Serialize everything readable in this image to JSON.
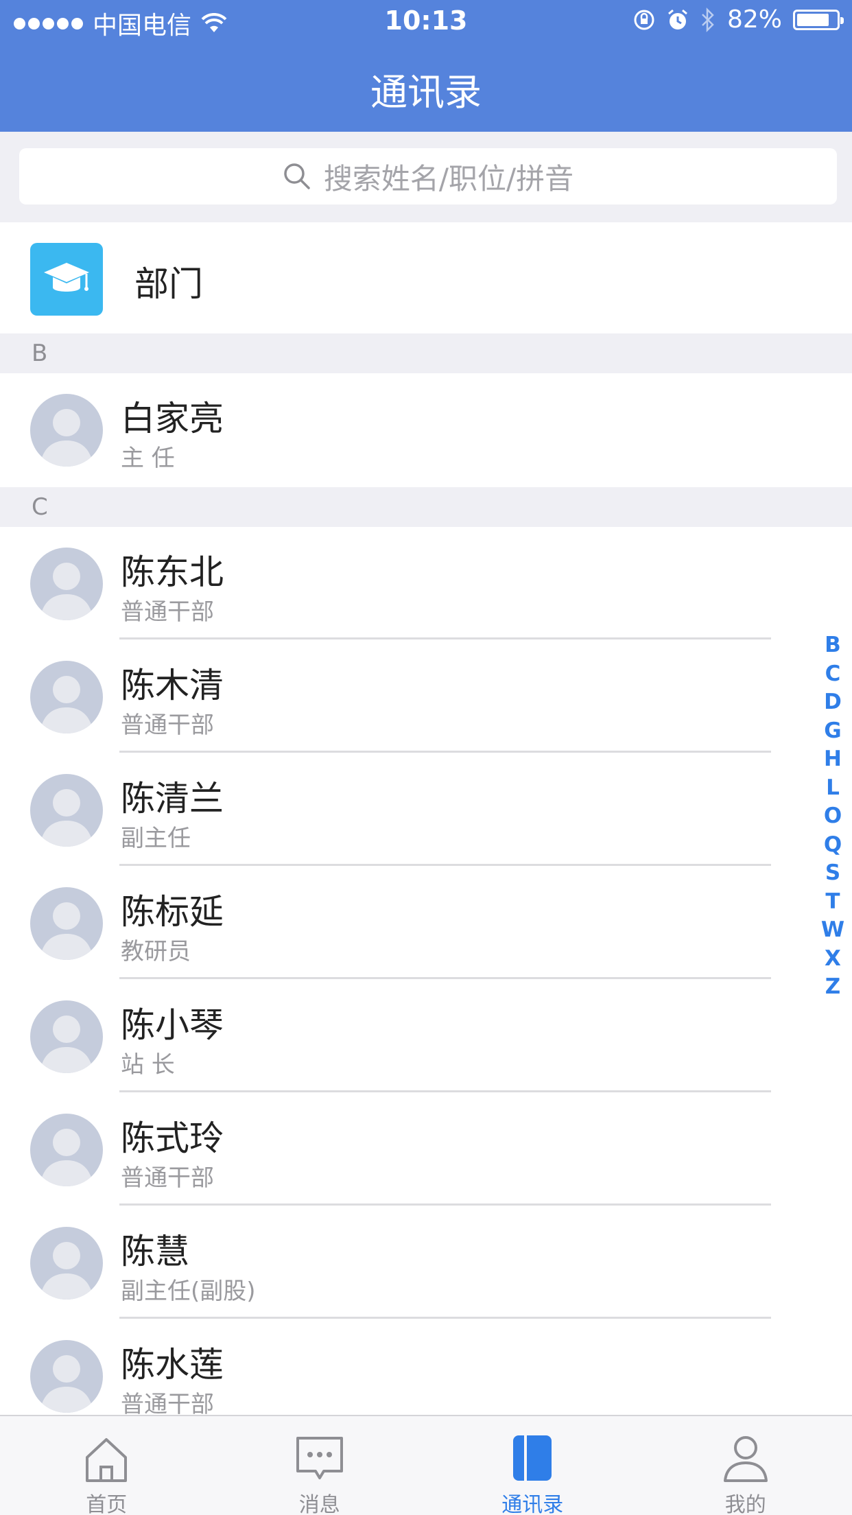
{
  "status_bar": {
    "carrier": "中国电信",
    "time": "10:13",
    "battery": "82%",
    "battery_level": 0.82,
    "icons": [
      "signal-dots-icon",
      "wifi-icon",
      "orientation-lock-icon",
      "alarm-icon",
      "bluetooth-icon",
      "battery-icon"
    ]
  },
  "nav": {
    "title": "通讯录"
  },
  "search": {
    "placeholder": "搜索姓名/职位/拼音",
    "icon": "search-icon"
  },
  "department": {
    "label": "部门",
    "icon": "graduation-cap-icon",
    "icon_bg": "#3bb8f0"
  },
  "sections": [
    {
      "letter": "B",
      "contacts": [
        {
          "name": "白家亮",
          "title": "主 任"
        }
      ]
    },
    {
      "letter": "C",
      "contacts": [
        {
          "name": "陈东北",
          "title": "普通干部"
        },
        {
          "name": "陈木清",
          "title": "普通干部"
        },
        {
          "name": "陈清兰",
          "title": "副主任"
        },
        {
          "name": "陈标延",
          "title": "教研员"
        },
        {
          "name": "陈小琴",
          "title": "站 长"
        },
        {
          "name": "陈式玲",
          "title": "普通干部"
        },
        {
          "name": "陈慧",
          "title": "副主任(副股)"
        },
        {
          "name": "陈水莲",
          "title": "普通干部"
        }
      ]
    }
  ],
  "alphabet_index": [
    "B",
    "C",
    "D",
    "G",
    "H",
    "L",
    "O",
    "Q",
    "S",
    "T",
    "W",
    "X",
    "Z"
  ],
  "tab_bar": {
    "tabs": [
      {
        "label": "首页",
        "icon": "home-icon"
      },
      {
        "label": "消息",
        "icon": "message-icon"
      },
      {
        "label": "通讯录",
        "icon": "contacts-book-icon",
        "active": true
      },
      {
        "label": "我的",
        "icon": "user-icon"
      }
    ]
  },
  "colors": {
    "header_bg": "#5583dc",
    "accent": "#2f7ee8",
    "section_bg": "#efeff4",
    "avatar_bg": "#c5ccdc"
  }
}
